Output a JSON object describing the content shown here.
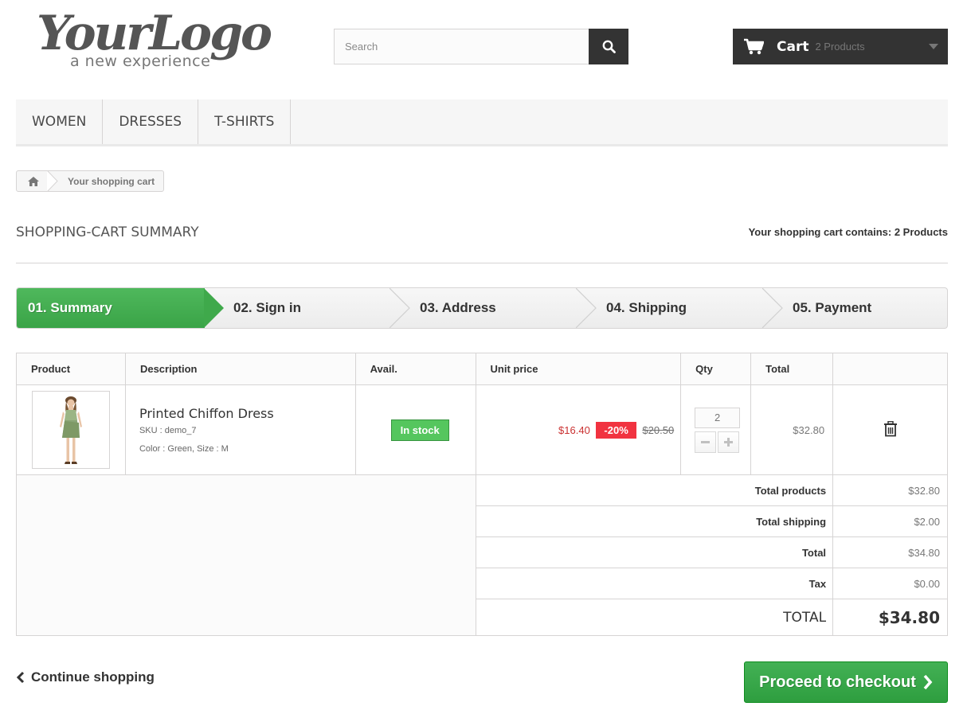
{
  "logo": {
    "main": "YourLogo",
    "sub": "a new experience"
  },
  "search": {
    "placeholder": "Search",
    "value": ""
  },
  "cart": {
    "label": "Cart",
    "count": "2 Products"
  },
  "nav": [
    "WOMEN",
    "DRESSES",
    "T-SHIRTS"
  ],
  "breadcrumb": {
    "current": "Your shopping cart"
  },
  "heading": {
    "title": "SHOPPING-CART SUMMARY",
    "contains_prefix": "Your shopping cart contains: ",
    "contains_count": "2 Products"
  },
  "steps": [
    "01. Summary",
    "02. Sign in",
    "03. Address",
    "04. Shipping",
    "05. Payment"
  ],
  "table": {
    "headers": [
      "Product",
      "Description",
      "Avail.",
      "Unit price",
      "Qty",
      "Total"
    ],
    "item": {
      "name": "Printed Chiffon Dress",
      "sku": "SKU : demo_7",
      "attributes": "Color : Green, Size : M",
      "availability": "In stock",
      "price": "$16.40",
      "discount": "-20%",
      "old_price": "$20.50",
      "qty": "2",
      "total": "$32.80"
    }
  },
  "summary": {
    "total_products_label": "Total products",
    "total_products": "$32.80",
    "total_shipping_label": "Total shipping",
    "total_shipping": "$2.00",
    "total_label": "Total",
    "total": "$34.80",
    "tax_label": "Tax",
    "tax": "$0.00",
    "grand_label": "TOTAL",
    "grand": "$34.80"
  },
  "actions": {
    "continue": "Continue shopping",
    "checkout": "Proceed to checkout"
  },
  "colors": {
    "accent_green": "#3aa447",
    "dark": "#333333",
    "sale_red": "#f13340"
  }
}
